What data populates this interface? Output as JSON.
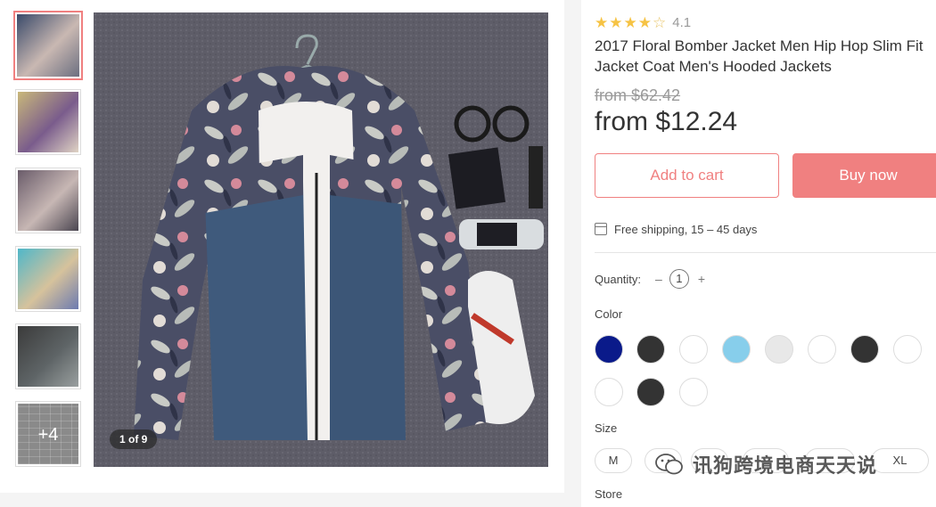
{
  "gallery": {
    "image_counter": "1 of 9",
    "thumbnails": [
      {
        "colors": [
          "#3a4a6a",
          "#c9b8b2",
          "#6c6f80"
        ]
      },
      {
        "colors": [
          "#c9b87a",
          "#7a5c8c",
          "#e0d4c4"
        ]
      },
      {
        "colors": [
          "#6a5c6a",
          "#c7b7b4",
          "#4a4550"
        ]
      },
      {
        "colors": [
          "#4fb7c9",
          "#d6c29c",
          "#6c7ab0"
        ]
      },
      {
        "colors": [
          "#3b3b3b",
          "#5e6466",
          "#9aa0a0"
        ]
      }
    ],
    "more_label": "+4"
  },
  "product": {
    "rating": "4.1",
    "stars": 4,
    "title_line1": "2017 Floral Bomber Jacket Men Hip Hop Slim Fit",
    "title_line2": "Jacket Coat Men's Hooded Jackets",
    "original_price": "from $62.42",
    "price": "from $12.24",
    "add_to_cart": "Add to cart",
    "buy_now": "Buy now",
    "shipping": "Free shipping, 15 – 45 days",
    "quantity_label": "Quantity:",
    "quantity_minus": "–",
    "quantity_value": "1",
    "quantity_plus": "+",
    "color_label": "Color",
    "colors": [
      "#0a1a8a",
      "#333333",
      "#ffffff",
      "#87ceeb",
      "#e8e8e8",
      "#ffffff",
      "#333333",
      "#ffffff",
      "#ffffff",
      "#333333",
      "#ffffff"
    ],
    "size_label": "Size",
    "sizes": [
      "M",
      "",
      "",
      "",
      "",
      "XL"
    ],
    "store_label": "Store"
  },
  "watermark": {
    "text": "讯狗跨境电商天天说"
  },
  "theme": {
    "accent": "#f08080",
    "star": "#f6c344"
  }
}
